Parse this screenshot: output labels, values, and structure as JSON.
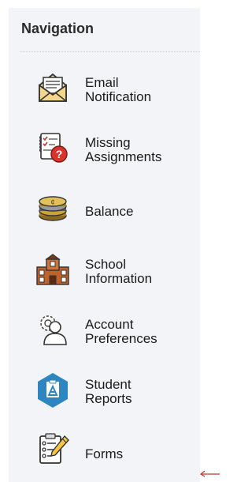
{
  "navigation": {
    "heading": "Navigation",
    "items": [
      {
        "label": "Email\nNotification",
        "icon": "email-envelope-icon"
      },
      {
        "label": "Missing\nAssignments",
        "icon": "missing-assignments-icon"
      },
      {
        "label": "Balance",
        "icon": "coins-icon"
      },
      {
        "label": "School\nInformation",
        "icon": "school-building-icon"
      },
      {
        "label": "Account\nPreferences",
        "icon": "account-gear-icon"
      },
      {
        "label": "Student\nReports",
        "icon": "student-reports-icon"
      },
      {
        "label": "Forms",
        "icon": "forms-clipboard-icon"
      }
    ]
  },
  "colors": {
    "panel_background": "#f2f4f7",
    "reports_hexagon": "#2e86c1",
    "indicator_arrow": "#c0392b"
  }
}
